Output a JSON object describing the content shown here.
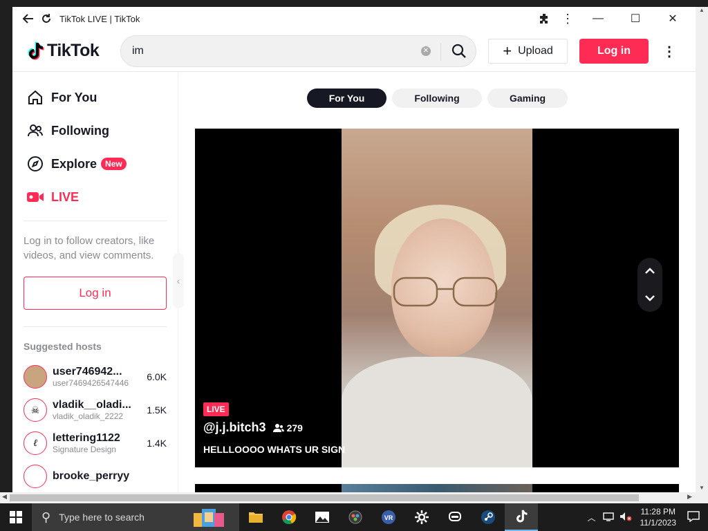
{
  "window": {
    "title": "TikTok LIVE | TikTok"
  },
  "header": {
    "logo": "TikTok",
    "search_value": "im",
    "upload_label": "Upload",
    "login_label": "Log in"
  },
  "sidebar": {
    "nav": [
      {
        "label": "For You",
        "icon": "home-icon"
      },
      {
        "label": "Following",
        "icon": "users-icon"
      },
      {
        "label": "Explore",
        "icon": "compass-icon",
        "badge": "New"
      },
      {
        "label": "LIVE",
        "icon": "live-camera-icon"
      }
    ],
    "login_prompt": "Log in to follow creators, like videos, and view comments.",
    "login_button": "Log in",
    "suggested_title": "Suggested hosts",
    "hosts": [
      {
        "name": "user746942...",
        "sub": "user7469426547446",
        "count": "6.0K"
      },
      {
        "name": "vladik__oladi...",
        "sub": "vladik_oladik_2222",
        "count": "1.5K"
      },
      {
        "name": "lettering1122",
        "sub": "Signature Design",
        "count": "1.4K"
      },
      {
        "name": "brooke_perryy",
        "sub": "",
        "count": ""
      }
    ]
  },
  "main": {
    "tabs": [
      "For You",
      "Following",
      "Gaming"
    ],
    "active_tab": "For You",
    "stream": {
      "badge": "LIVE",
      "username": "@j.j.bitch3",
      "viewers": "279",
      "title": "HELLLOOOO WHATS UR SIGN"
    }
  },
  "taskbar": {
    "search_placeholder": "Type here to search",
    "time": "11:28 PM",
    "date": "11/1/2023"
  },
  "colors": {
    "brand": "#fe2c55",
    "dark": "#161823"
  }
}
